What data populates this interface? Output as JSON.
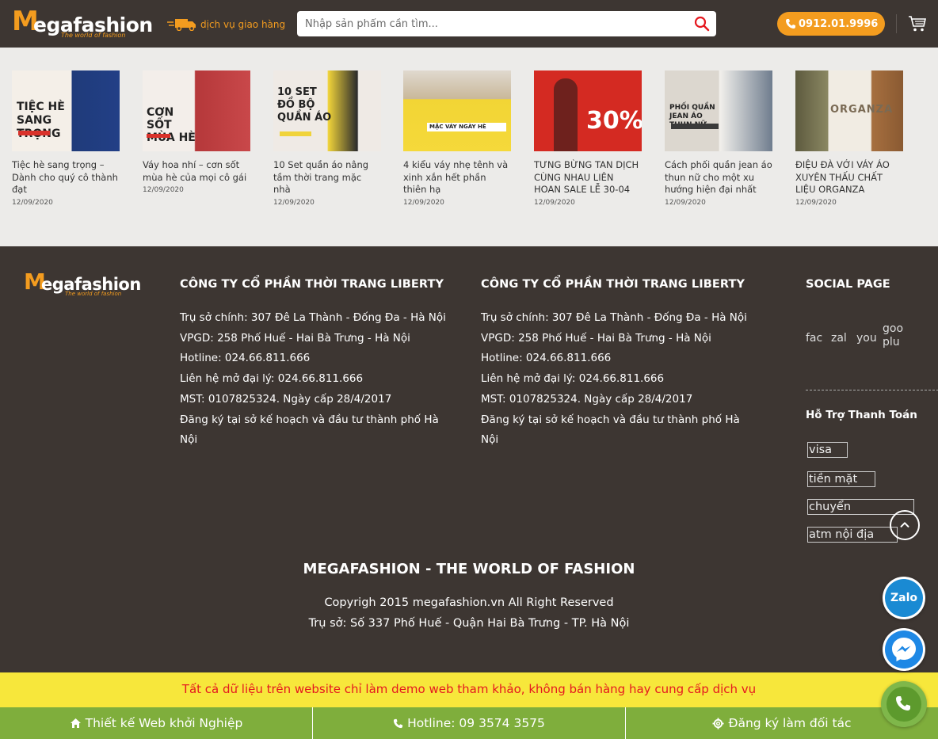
{
  "header": {
    "logo_m": "M",
    "logo_rest": "egafashion",
    "logo_tag": "The world of fashion",
    "delivery_label": "dịch vụ giao hàng",
    "search_placeholder": "Nhập sản phẩm cần tìm...",
    "phone": "0912.01.9996"
  },
  "articles": [
    {
      "title": "Tiệc hè sang trọng – Dành cho quý cô thành đạt",
      "date": "12/09/2020",
      "thumb_text": "TIỆC HÈ SANG TRỌNG"
    },
    {
      "title": "Váy hoa nhí – cơn sốt mùa hè của mọi cô gái",
      "date": "12/09/2020",
      "thumb_text": "CƠN SỐT MÙA HÈ"
    },
    {
      "title": "10 Set quần áo nâng tầm thời trang mặc nhà",
      "date": "12/09/2020",
      "thumb_text": "10 SET ĐỒ BỘ QUẦN ÁO"
    },
    {
      "title": "4 kiểu váy nhẹ tênh và xinh xắn hết phần thiên hạ",
      "date": "12/09/2020",
      "thumb_text": "MẶC VÁY NGÀY HÈ"
    },
    {
      "title": "TƯNG BỪNG TAN DỊCH CÙNG NHAU LIÊN HOAN SALE LỄ 30-04",
      "date": "12/09/2020",
      "thumb_text": "30%"
    },
    {
      "title": "Cách phối quần jean áo thun nữ cho một xu hướng hiện đại nhất",
      "date": "12/09/2020",
      "thumb_text": "PHỐI QUẦN JEAN ÁO THUN NỮ"
    },
    {
      "title": "ĐIỆU ĐÀ VỚI VÁY ÁO XUYÊN THẤU CHẤT LIỆU ORGANZA",
      "date": "12/09/2020",
      "thumb_text": "ORGANZA"
    }
  ],
  "footer": {
    "logo_m": "M",
    "logo_rest": "egafashion",
    "logo_tag": "The world of fashion",
    "companies": [
      {
        "title": "CÔNG TY CỔ PHẦN THỜI TRANG LIBERTY",
        "lines": [
          "Trụ sở chính: 307 Đê La Thành - Đống Đa - Hà Nội",
          "VPGD: 258 Phố Huế - Hai Bà Trưng - Hà Nội",
          "Hotline: 024.66.811.666",
          "Liên hệ mở đại lý: 024.66.811.666",
          "MST: 0107825324. Ngày cấp 28/4/2017",
          "Đăng ký tại sở kế hoạch và đầu tư thành phố Hà Nội"
        ]
      },
      {
        "title": "CÔNG TY CỔ PHẦN THỜI TRANG LIBERTY",
        "lines": [
          "Trụ sở chính: 307 Đê La Thành - Đống Đa - Hà Nội",
          "VPGD: 258 Phố Huế - Hai Bà Trưng - Hà Nội",
          "Hotline: 024.66.811.666",
          "Liên hệ mở đại lý: 024.66.811.666",
          "MST: 0107825324. Ngày cấp 28/4/2017",
          "Đăng ký tại sở kế hoạch và đầu tư thành phố Hà Nội"
        ]
      }
    ],
    "social_title": "SOCIAL PAGE",
    "social_icons": [
      "fac",
      "zal",
      "you",
      "goo plu"
    ],
    "payment_title": "Hỗ Trợ Thanh Toán",
    "payments": [
      "visa",
      "tiền mặt",
      "chuyển",
      "atm nội địa"
    ],
    "tagline": "MEGAFASHION - THE WORLD OF FASHION",
    "copyright": "Copyrigh 2015 megafashion.vn All Right Reserved",
    "address": "Trụ sở: Số 337 Phố Huế - Quận Hai Bà Trưng - TP. Hà Nội"
  },
  "warning": "Tất cả dữ liệu trên website chỉ làm demo web tham khảo, không bán hàng hay cung cấp dịch vụ",
  "bottom_bar": {
    "web_label": "Thiết kế Web khởi Nghiệp",
    "hotline_label": "Hotline: 09 3574 3575",
    "partner_label": "Đăng ký làm đối tác"
  },
  "floating": {
    "zalo_label": "Zalo"
  },
  "colors": {
    "brand_orange": "#f39c1f",
    "dark_bg": "#3d3632",
    "warning_yellow": "#f7e73b",
    "warning_red": "#e5181f",
    "green_bar": "#7fae3c"
  }
}
